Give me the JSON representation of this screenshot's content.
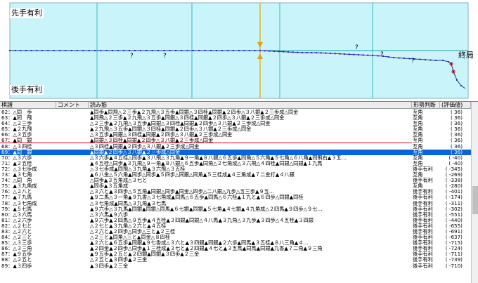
{
  "graph": {
    "top_label": "先手有利",
    "bottom_label": "後手有利",
    "end_label": "終局",
    "question_mark": "?",
    "colors": {
      "band": "#c8f4fa",
      "line": "#2030b0",
      "cursor": "#e8a000",
      "center": "#20a0a8",
      "error": "#e00000"
    }
  },
  "table": {
    "headers": {
      "move": "棋譜",
      "comment": "コメント",
      "reading": "読み筋",
      "judgement": "形勢判断",
      "evaluation": "評価値"
    },
    "rows": [
      {
        "move": "62：△同　歩",
        "comment": "",
        "reading": "▲同歩▲同飛△２三歩▲２九飛△３五歩▲同銀△３四桂▲同銀▲２四歩△３八銀▲２三歩成△同金",
        "judgement": "互角",
        "evaluation": "( 36)"
      },
      {
        "move": "63：▲同　飛",
        "comment": "",
        "reading": "▲同飛△２三歩▲２九飛△３五歩▲同銀△３四桂▲同銀▲２四歩△３八銀▲２三歩成△同金",
        "judgement": "互角",
        "evaluation": "( 36)"
      },
      {
        "move": "64：△２三歩",
        "comment": "",
        "reading": "△２三歩▲２九飛△３五歩▲同銀△３四桂▲同銀▲２四歩△３八銀▲２三歩成△同金",
        "judgement": "互角",
        "evaluation": "( 36)"
      },
      {
        "move": "65：▲２九飛",
        "comment": "",
        "reading": "▲２九飛△３五歩▲同銀△３四桂▲同銀▲２四歩△３八銀▲２三歩成△同金",
        "judgement": "互角",
        "evaluation": "( 36)"
      },
      {
        "move": "66：△３五歩",
        "comment": "",
        "reading": "△３五歩▲同銀△３四桂▲同銀▲２四歩△３八銀▲２三歩成△同金",
        "judgement": "互角",
        "evaluation": "( 36)"
      },
      {
        "move": "67：▲同　銀",
        "comment": "",
        "reading": "▲同銀△３四桂▲同銀▲２四歩△３八銀▲２三歩成△同金",
        "judgement": "互角",
        "evaluation": "( 36)"
      },
      {
        "move": "68：△３四桂",
        "comment": "",
        "reading": "△３四桂▲同銀▲２四歩△３八銀▲２三歩成△同金",
        "judgement": "互角",
        "evaluation": "( 36)"
      },
      {
        "move": "69：▲同　銀",
        "comment": "",
        "reading": "▲同銀▲２四歩△３八銀▲２三歩成△同金",
        "judgement": "互角",
        "evaluation": "( 36)",
        "current": true
      },
      {
        "move": "70：△３六歩",
        "comment": "",
        "reading": "△３六歩▲４五桂△同歩▲３八飛△３九角▲９一角▲８八銀△６五歩▲同角△５六角▲５七角△６八角▲同飛右▲３五…",
        "judgement": "互角",
        "evaluation": "( -40)"
      },
      {
        "move": "71：▲２五桂",
        "comment": "",
        "reading": "▲４五桂△同歩▲３九飛△９一角▲８八銀△６五歩▲同角△２七角成△３六飛△４四桂▲同銀△同銀▲１九馬",
        "judgement": "互角",
        "evaluation": "( -40)"
      },
      {
        "move": "72：△３七歩成",
        "comment": "",
        "reading": "△３七歩成▲同飛△３九角▲３六飛△３五桂",
        "judgement": "後手有利",
        "evaluation": "( -345)"
      },
      {
        "move": "73：▲３七角",
        "comment": "",
        "reading": "▲６八金△５六角▲同歩△同歩▲５四歩△同銀△同角▲５三桂成▲４三角成▲７二金打▲４八銀",
        "judgement": "互角",
        "evaluation": "( -269)"
      },
      {
        "move": "74：△同　角",
        "comment": "",
        "reading": "△同歩▲３五角成△３七と",
        "judgement": "後手有利",
        "evaluation": "( -338)"
      },
      {
        "move": "75：▲３九角成",
        "comment": "",
        "reading": "▲同歩▲３五角成",
        "judgement": "互角",
        "evaluation": "( -280)"
      },
      {
        "move": "76：△２八と",
        "comment": "",
        "reading": "△３六と▲３四歩△５五角▲同銀△同歩▲同金△四歩△二八銀△九歩△五三歩▲９五…",
        "judgement": "後手有利",
        "evaluation": "( -401)"
      },
      {
        "move": "77：▲７九馬",
        "comment": "",
        "reading": "▲９二馬△３一角▲９九香△３七角成▲同馬△６五歩▲同馬△６六桂▲１九と▲６四歩△同銀▲同桂",
        "judgement": "後手有利",
        "evaluation": "( -174)"
      },
      {
        "move": "78：△３七角成",
        "comment": "",
        "reading": "△３七角成▲同馬△３九角▲３七馬",
        "judgement": "後手有利",
        "evaluation": "( -311)"
      },
      {
        "move": "79：▲５七馬",
        "comment": "",
        "reading": "▲９六歩△３九馬▲同銀▲同銀△同馬▲６七銀▲同銀▲５七角▲４七銀▲４九角成△２四馬▲９四歩△９七…",
        "judgement": "後手有利",
        "evaluation": "( -302)"
      },
      {
        "move": "80：△３六馬",
        "comment": "",
        "reading": "△３六馬▲９六歩",
        "judgement": "後手有利",
        "evaluation": "( -551)"
      },
      {
        "move": "81：△２六歩",
        "comment": "",
        "reading": "▲９六歩▲２四馬△９五歩▲４五桂▲３四銀▲同銀△４八馬▲３九角△３九歩▲３四歩△４五桂▲３四銀",
        "judgement": "後手有利",
        "evaluation": "( -440)"
      },
      {
        "move": "82：△２七と",
        "comment": "",
        "reading": "△２七と▲３九角△２六と▲４五桂",
        "judgement": "後手有利",
        "evaluation": "( -655)"
      },
      {
        "move": "83：△２六と",
        "comment": "",
        "reading": "△２六と▲２四歩△同歩△三と▲２三桂",
        "judgement": "後手有利",
        "evaluation": "( -691)"
      },
      {
        "move": "84：△２三と",
        "comment": "",
        "reading": "△２三と▲同角△三と▲同金△８四桂",
        "judgement": "後手有利",
        "evaluation": "( -637)"
      },
      {
        "move": "85：△３三歩",
        "comment": "",
        "reading": "▲２六と▲６五歩▲同銀▲９七香成△３六と▲３四銀▲同銀▲２六歩▲同馬▲３五桂▲８八三角▲４…",
        "judgement": "後手有利",
        "evaluation": "( -715)"
      },
      {
        "move": "86：△３三角",
        "comment": "",
        "reading": "▲２四金▲２四歩△同歩▲１三桂成▲３七と▲２四銀▲４七と▲３五馬▲同馬▲同銀▲九香▲７二角▲９三角",
        "judgement": "後手有利",
        "evaluation": "( -724)"
      },
      {
        "move": "87：▲９五歩",
        "comment": "",
        "reading": "▲９五歩▲２五と▲２四銀▲同銀▲３四歩▲２三金",
        "judgement": "後手有利",
        "evaluation": "( -711)"
      },
      {
        "move": "88：△２五と",
        "comment": "",
        "reading": "△２五と▲３四歩▲２三金",
        "judgement": "後手有利",
        "evaluation": "( -739)"
      },
      {
        "move": "89：▲３四歩",
        "comment": "",
        "reading": "▲３四歩▲２三金",
        "judgement": "後手有利",
        "evaluation": "( -710)"
      }
    ]
  }
}
